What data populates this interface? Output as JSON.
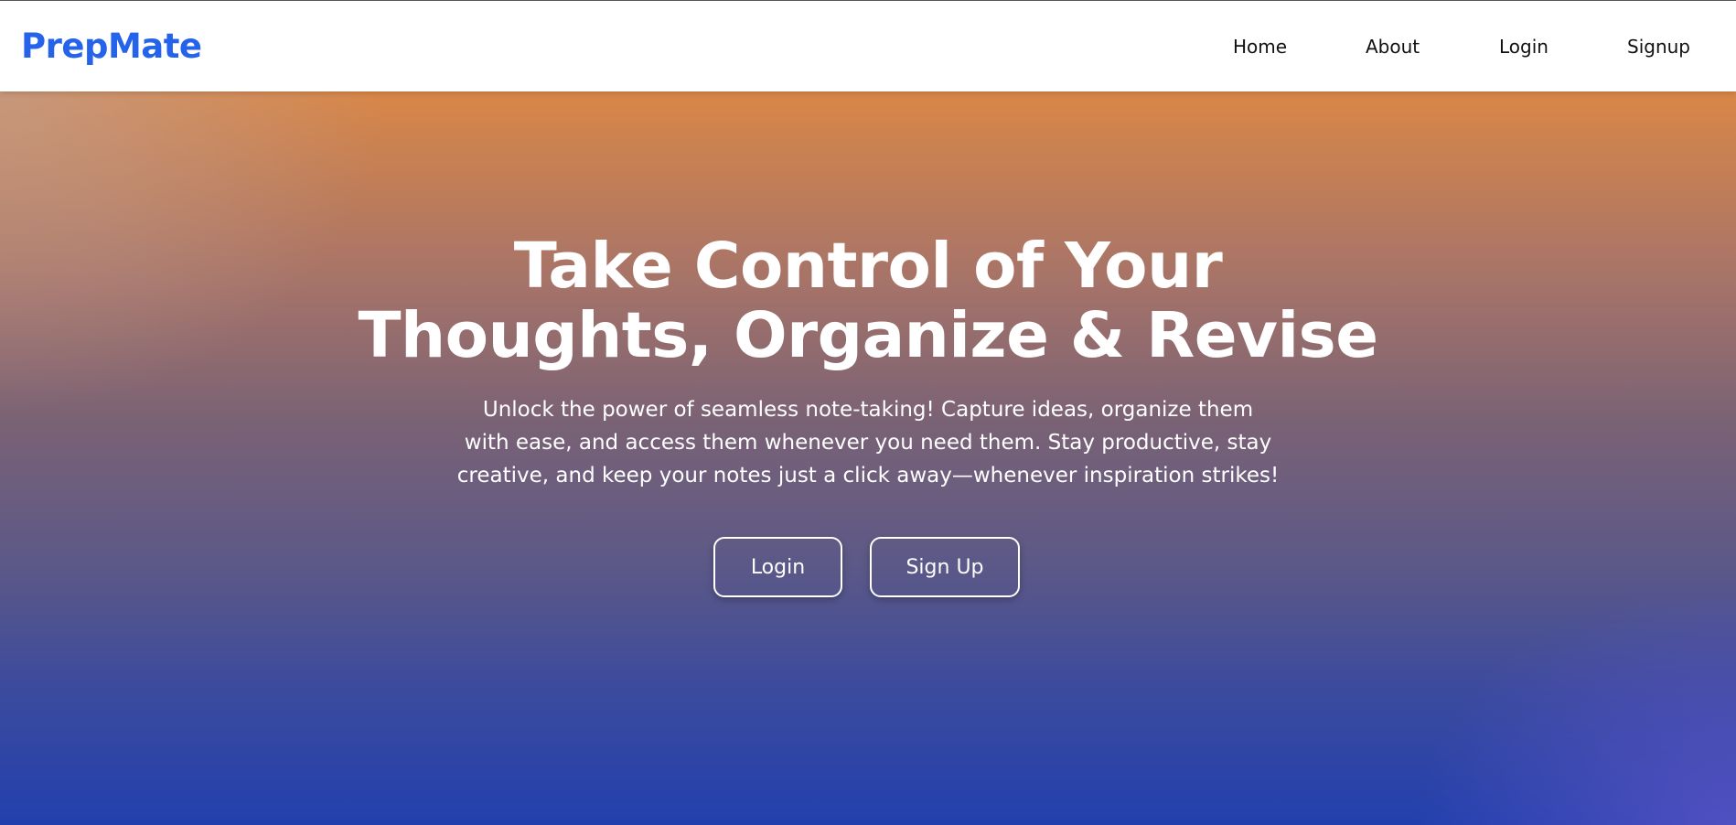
{
  "brand": {
    "name": "PrepMate",
    "color": "#2563eb"
  },
  "nav": {
    "items": [
      {
        "label": "Home"
      },
      {
        "label": "About"
      },
      {
        "label": "Login"
      },
      {
        "label": "Signup"
      }
    ]
  },
  "hero": {
    "title_lines": [
      "Take Control of Your",
      "Thoughts, Organize & Revise"
    ],
    "description_lines": [
      "Unlock the power of seamless note-taking! Capture ideas, organize them",
      "with ease, and access them whenever you need them. Stay productive, stay",
      "creative, and keep your notes just a click away—whenever inspiration strikes!"
    ],
    "buttons": {
      "login_label": "Login",
      "signup_label": "Sign Up"
    },
    "gradient_colors": [
      "#d98747",
      "#7a6275",
      "#2240ad"
    ]
  }
}
